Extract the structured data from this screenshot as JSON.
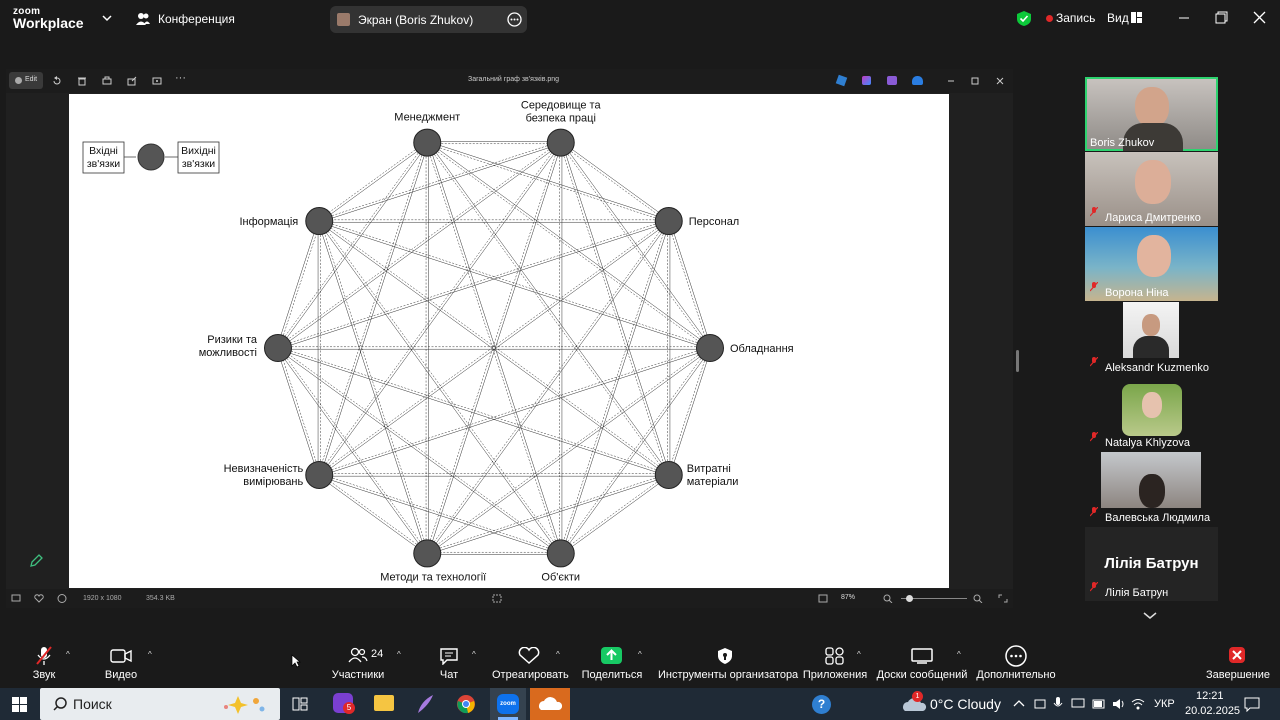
{
  "app": {
    "logo_top": "zoom",
    "logo_bottom": "Workplace",
    "meeting_menu": "Конференция",
    "share_label": "Экран (Boris Zhukov)",
    "record_label": "Запись",
    "view_label": "Вид",
    "colors": {
      "accent": "#0e72ed",
      "green": "#0cc93a",
      "red": "#e02828",
      "share": "#17c964"
    }
  },
  "viewer": {
    "edit_label": "Edit",
    "title": "Загальний граф зв'язків.png",
    "dimensions": "1920 x 1080",
    "filesize": "354.3 KB",
    "zoom": "87%"
  },
  "diagram": {
    "legend_in": "Вхідні зв'язки",
    "legend_out": "Вихідні зв'язки",
    "nodes": [
      {
        "label": "Менеджмент"
      },
      {
        "label": "Середовище та безпека праці"
      },
      {
        "label": "Персонал"
      },
      {
        "label": "Обладнання"
      },
      {
        "label": "Витратні матеріали"
      },
      {
        "label": "Об'єкти"
      },
      {
        "label": "Методи та технології"
      },
      {
        "label": "Невизначеність вимірювань"
      },
      {
        "label": "Ризики та можливості"
      },
      {
        "label": "Інформація"
      }
    ]
  },
  "participants": [
    {
      "name": "Boris Zhukov",
      "muted": false
    },
    {
      "name": "Лариса Дмитренко",
      "muted": true
    },
    {
      "name": "Ворона Ніна",
      "muted": true
    },
    {
      "name": "Aleksandr Kuzmenko",
      "muted": true
    },
    {
      "name": "Natalya Khlyzova",
      "muted": true
    },
    {
      "name": "Валевська Людмила",
      "muted": true
    },
    {
      "name": "Лілія Батрун",
      "muted": true,
      "big_name": "Лілія Батрун"
    }
  ],
  "toolbar": {
    "audio": "Звук",
    "video": "Видео",
    "participants": "Участники",
    "participants_count": "24",
    "chat": "Чат",
    "react": "Отреагировать",
    "share": "Поделиться",
    "host_tools": "Инструменты организатора",
    "apps": "Приложения",
    "whiteboards": "Доски сообщений",
    "more": "Дополнительно",
    "end": "Завершение"
  },
  "taskbar": {
    "search_placeholder": "Поиск",
    "weather": "0°C Cloudy",
    "lang": "УКР",
    "time": "12:21",
    "date": "20.02.2025",
    "badge_count": "5",
    "weather_badge": "1"
  }
}
